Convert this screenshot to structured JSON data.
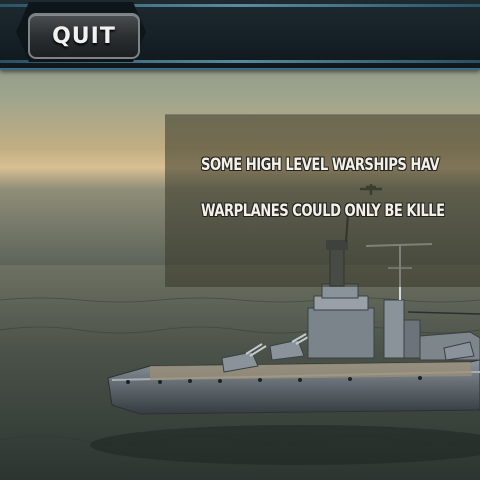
{
  "toolbar": {
    "quit_label": "QUIT"
  },
  "message": {
    "line1": "SOME HIGH LEVEL WARSHIPS HAV",
    "line2": "WARPLANES COULD ONLY BE KILLE"
  },
  "colors": {
    "sky": "#8a9684",
    "sea": "#3a4641",
    "panel": "#373628",
    "bar_accent": "#3d6a7e"
  }
}
